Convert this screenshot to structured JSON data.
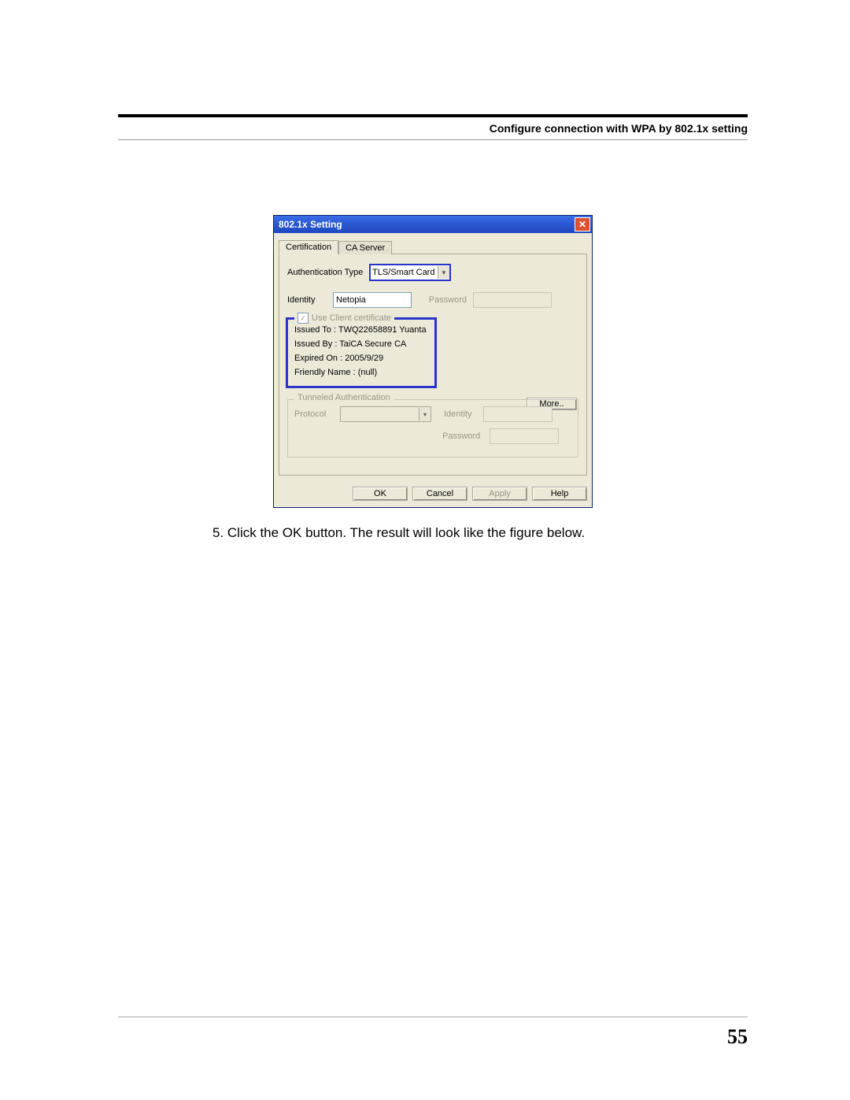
{
  "header": {
    "title": "Configure connection with WPA by 802.1x setting"
  },
  "dialog": {
    "title": "802.1x Setting",
    "close_glyph": "✕",
    "tabs": [
      "Certification",
      "CA Server"
    ],
    "auth_type_label": "Authentication Type",
    "auth_type_value": "TLS/Smart Card",
    "identity_label": "Identity",
    "identity_value": "Netopia",
    "password_label": "Password",
    "use_client_cert_label": "Use Client certificate",
    "cert": {
      "issued_to": "Issued To :  TWQ22658891 Yuanta",
      "issued_by": "Issued By :  TaiCA Secure CA",
      "expired_on": "Expired On :  2005/9/29",
      "friendly_name": "Friendly Name :  (null)"
    },
    "more_label": "More..",
    "tunneled": {
      "legend": "Tunneled Authentication",
      "protocol_label": "Protocol",
      "identity_label": "Identity",
      "password_label": "Password"
    },
    "buttons": {
      "ok": "OK",
      "cancel": "Cancel",
      "apply": "Apply",
      "help": "Help"
    }
  },
  "caption": "5. Click the OK button. The result will look like the figure below.",
  "page_number": "55"
}
